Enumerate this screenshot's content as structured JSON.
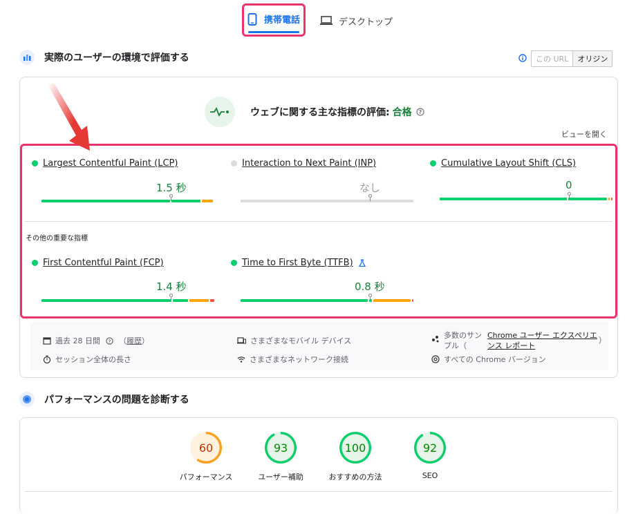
{
  "tabs": {
    "mobile": "携帯電話",
    "desktop": "デスクトップ"
  },
  "field": {
    "title": "実際のユーザーの環境で評価する",
    "toggle": {
      "this_url": "この URL",
      "origin": "オリジン"
    },
    "cwv_label": "ウェブに関する主な指標の評価:",
    "cwv_status": "合格",
    "expand": "ビューを開く",
    "other_metrics": "その他の重要な指標",
    "metrics": {
      "lcp": {
        "name": "Largest Contentful Paint (LCP)",
        "value": "1.5 秒"
      },
      "inp": {
        "name": "Interaction to Next Paint (INP)",
        "value": "なし"
      },
      "cls": {
        "name": "Cumulative Layout Shift (CLS)",
        "value": "0"
      },
      "fcp": {
        "name": "First Contentful Paint (FCP)",
        "value": "1.4 秒"
      },
      "ttfb": {
        "name": "Time to First Byte (TTFB)",
        "value": "0.8 秒"
      }
    },
    "footer": {
      "period": "過去 28 日間",
      "history_open": "（",
      "history": "履歴",
      "history_close": "）",
      "session": "セッション全体の長さ",
      "devices": "さまざまなモバイル デバイス",
      "network": "さまざまなネットワーク接続",
      "samples_a": "多数のサン",
      "samples_b": "プル（",
      "crux_a": "Chrome ユーザー エクスペリエ",
      "crux_b": "ンス レポート",
      "samples_close": "）",
      "versions": "すべての Chrome バージョン"
    }
  },
  "lab": {
    "title": "パフォーマンスの問題を診断する",
    "scores": [
      {
        "label": "パフォーマンス",
        "score": "60",
        "level": 0.6,
        "color": "#fa9f20"
      },
      {
        "label": "ユーザー補助",
        "score": "93",
        "level": 0.93,
        "color": "#0cce6b"
      },
      {
        "label": "おすすめの方法",
        "score": "100",
        "level": 1.0,
        "color": "#0cce6b"
      },
      {
        "label": "SEO",
        "score": "92",
        "level": 0.92,
        "color": "#0cce6b"
      }
    ]
  },
  "colors": {
    "good": "#0cce6b",
    "average": "#ffa400",
    "poor": "#ff4e42",
    "accent": "#1a73e8",
    "highlight": "#e8336b",
    "arrow": "#e53935"
  }
}
